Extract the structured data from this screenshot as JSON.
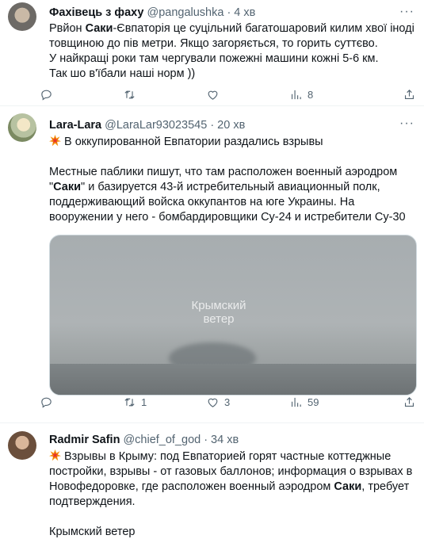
{
  "tweets": [
    {
      "name": "Фахівець з фаху",
      "handle": "@pangalushka",
      "dot": "·",
      "time": "4 хв",
      "segments": [
        {
          "b": "Саки"
        },
        {
          "t": "-Євпаторія це суцільний багатошаровий килим хвої іноді товщиною до пів метри. Якщо загоряється, то горить суттєво."
        }
      ],
      "prefix": "Рвйон ",
      "line2": "У найкращі роки там чергували пожежні машини кожні 5-6 км.",
      "line3": "Так шо в'їбали наші норм ))",
      "actions": {
        "reply": "",
        "retweet": "",
        "like": "",
        "views": "8"
      }
    },
    {
      "name": "Lara-Lara",
      "handle": "@LaraLar93023545",
      "dot": "·",
      "time": "20 хв",
      "headline": "В оккупированной Евпатории раздались взрывы",
      "para_a": "Местные паблики пишут, что там расположен военный аэродром",
      "quote_open": "\"",
      "bold": "Саки",
      "para_b": "\" и базируется 43-й истребительный авиационный полк, поддерживающий войска оккупантов на юге Украины. На вооружении у него - бомбардировщики Су-24 и истребители Су-30",
      "watermark_line1": "Крымский",
      "watermark_line2": "ветер",
      "actions": {
        "reply": "",
        "retweet": "1",
        "like": "3",
        "views": "59"
      }
    },
    {
      "name": "Radmir Safin",
      "handle": "@chief_of_god",
      "dot": "·",
      "time": "34 хв",
      "text_a": "Взрывы в Крыму: под Евпаторией горят частные коттеджные постройки, взрывы - от газовых баллонов; информация о взрывах в Новофедоровке, где расположен военный аэродром ",
      "bold": "Саки",
      "text_b": ", требует подтверждения.",
      "footer": "Крымский ветер"
    }
  ],
  "colors": {
    "text": "#0f1419",
    "muted": "#536471",
    "divider": "#eff3f4"
  },
  "icons": [
    "more-icon",
    "reply-icon",
    "retweet-icon",
    "like-icon",
    "views-icon",
    "share-icon",
    "collision-emoji-icon"
  ]
}
